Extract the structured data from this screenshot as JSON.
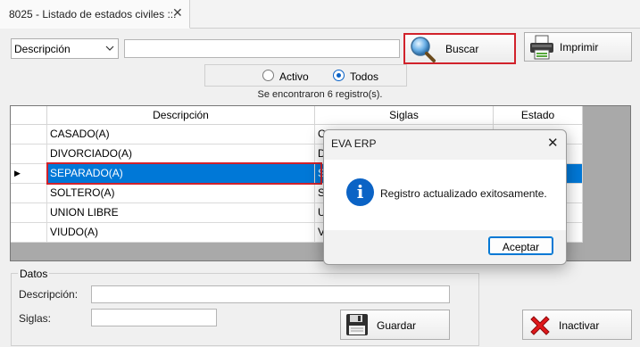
{
  "tab": {
    "title": "8025 - Listado de estados civiles ::.",
    "close": "✕"
  },
  "search": {
    "field_select": "Descripción",
    "query": "",
    "search_label": "Buscar",
    "print_label": "Imprimir"
  },
  "filter": {
    "options": [
      {
        "label": "Activo",
        "checked": false
      },
      {
        "label": "Todos",
        "checked": true
      }
    ]
  },
  "results_text": "Se encontraron 6 registro(s).",
  "grid": {
    "columns": [
      "Descripción",
      "Siglas",
      "Estado"
    ],
    "selected_index": 2,
    "row_marker": "▶",
    "rows": [
      {
        "descripcion": "CASADO(A)",
        "siglas": "C"
      },
      {
        "descripcion": "DIVORCIADO(A)",
        "siglas": "D"
      },
      {
        "descripcion": "SEPARADO(A)",
        "siglas": "S"
      },
      {
        "descripcion": "SOLTERO(A)",
        "siglas": "S"
      },
      {
        "descripcion": "UNION LIBRE",
        "siglas": "U"
      },
      {
        "descripcion": "VIUDO(A)",
        "siglas": "V"
      }
    ]
  },
  "datos": {
    "legend": "Datos",
    "descripcion_label": "Descripción:",
    "descripcion_value": "",
    "siglas_label": "Siglas:",
    "siglas_value": "",
    "save_label": "Guardar",
    "deactivate_label": "Inactivar"
  },
  "dialog": {
    "title": "EVA ERP",
    "close": "✕",
    "icon": "info-icon",
    "icon_glyph": "i",
    "message": "Registro actualizado exitosamente.",
    "ok_label": "Aceptar"
  },
  "colors": {
    "highlight": "#d1222b",
    "selection": "#0078d7",
    "info": "#0b63c5"
  }
}
